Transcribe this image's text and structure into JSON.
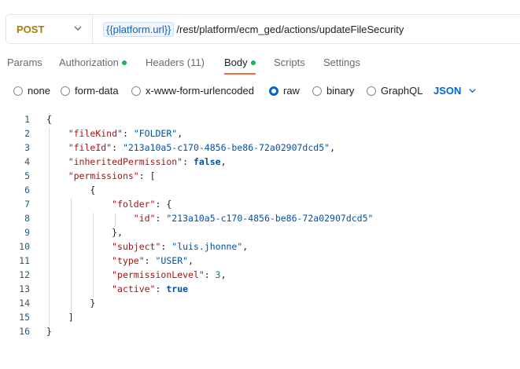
{
  "request": {
    "method": "POST",
    "url_variable": "{{platform.url}}",
    "url_path": "/rest/platform/ecm_ged/actions/updateFileSecurity"
  },
  "tabs": [
    {
      "label": "Params",
      "active": false,
      "dot": false
    },
    {
      "label": "Authorization",
      "active": false,
      "dot": true
    },
    {
      "label": "Headers (11)",
      "active": false,
      "dot": false
    },
    {
      "label": "Body",
      "active": true,
      "dot": true
    },
    {
      "label": "Scripts",
      "active": false,
      "dot": false
    },
    {
      "label": "Settings",
      "active": false,
      "dot": false
    }
  ],
  "body_options": [
    {
      "label": "none",
      "selected": false
    },
    {
      "label": "form-data",
      "selected": false
    },
    {
      "label": "x-www-form-urlencoded",
      "selected": false
    },
    {
      "label": "raw",
      "selected": true
    },
    {
      "label": "binary",
      "selected": false
    },
    {
      "label": "GraphQL",
      "selected": false
    }
  ],
  "language": "JSON",
  "colors": {
    "accent": "#0265d2",
    "method": "#ad7a03",
    "active_tab_underline": "#f26b3a",
    "status_dot": "#0cbb52"
  },
  "editor": {
    "lines": [
      {
        "n": "1",
        "tokens": [
          [
            "p",
            "{"
          ]
        ]
      },
      {
        "n": "2",
        "tokens": [
          [
            "p",
            "    "
          ],
          [
            "k",
            "\"fileKind\""
          ],
          [
            "p",
            ": "
          ],
          [
            "s",
            "\"FOLDER\""
          ],
          [
            "p",
            ","
          ]
        ]
      },
      {
        "n": "3",
        "tokens": [
          [
            "p",
            "    "
          ],
          [
            "k",
            "\"fileId\""
          ],
          [
            "p",
            ": "
          ],
          [
            "s",
            "\"213a10a5-c170-4856-be86-72a02907dcd5\""
          ],
          [
            "p",
            ","
          ]
        ]
      },
      {
        "n": "4",
        "tokens": [
          [
            "p",
            "    "
          ],
          [
            "k",
            "\"inheritedPermission\""
          ],
          [
            "p",
            ": "
          ],
          [
            "b",
            "false"
          ],
          [
            "p",
            ","
          ]
        ]
      },
      {
        "n": "5",
        "tokens": [
          [
            "p",
            "    "
          ],
          [
            "k",
            "\"permissions\""
          ],
          [
            "p",
            ": ["
          ]
        ]
      },
      {
        "n": "6",
        "tokens": [
          [
            "p",
            "        {"
          ]
        ]
      },
      {
        "n": "7",
        "tokens": [
          [
            "p",
            "            "
          ],
          [
            "k",
            "\"folder\""
          ],
          [
            "p",
            ": {"
          ]
        ]
      },
      {
        "n": "8",
        "tokens": [
          [
            "p",
            "                "
          ],
          [
            "k",
            "\"id\""
          ],
          [
            "p",
            ": "
          ],
          [
            "s",
            "\"213a10a5-c170-4856-be86-72a02907dcd5\""
          ]
        ]
      },
      {
        "n": "9",
        "tokens": [
          [
            "p",
            "            },"
          ]
        ]
      },
      {
        "n": "10",
        "tokens": [
          [
            "p",
            "            "
          ],
          [
            "k",
            "\"subject\""
          ],
          [
            "p",
            ": "
          ],
          [
            "s",
            "\"luis.jhonne\""
          ],
          [
            "p",
            ","
          ]
        ]
      },
      {
        "n": "11",
        "tokens": [
          [
            "p",
            "            "
          ],
          [
            "k",
            "\"type\""
          ],
          [
            "p",
            ": "
          ],
          [
            "s",
            "\"USER\""
          ],
          [
            "p",
            ","
          ]
        ]
      },
      {
        "n": "12",
        "tokens": [
          [
            "p",
            "            "
          ],
          [
            "k",
            "\"permissionLevel\""
          ],
          [
            "p",
            ": "
          ],
          [
            "n",
            "3"
          ],
          [
            "p",
            ","
          ]
        ]
      },
      {
        "n": "13",
        "tokens": [
          [
            "p",
            "            "
          ],
          [
            "k",
            "\"active\""
          ],
          [
            "p",
            ": "
          ],
          [
            "b",
            "true"
          ]
        ]
      },
      {
        "n": "14",
        "tokens": [
          [
            "p",
            "        }"
          ]
        ]
      },
      {
        "n": "15",
        "tokens": [
          [
            "p",
            "    ]"
          ]
        ]
      },
      {
        "n": "16",
        "tokens": [
          [
            "p",
            "}"
          ]
        ]
      }
    ]
  }
}
